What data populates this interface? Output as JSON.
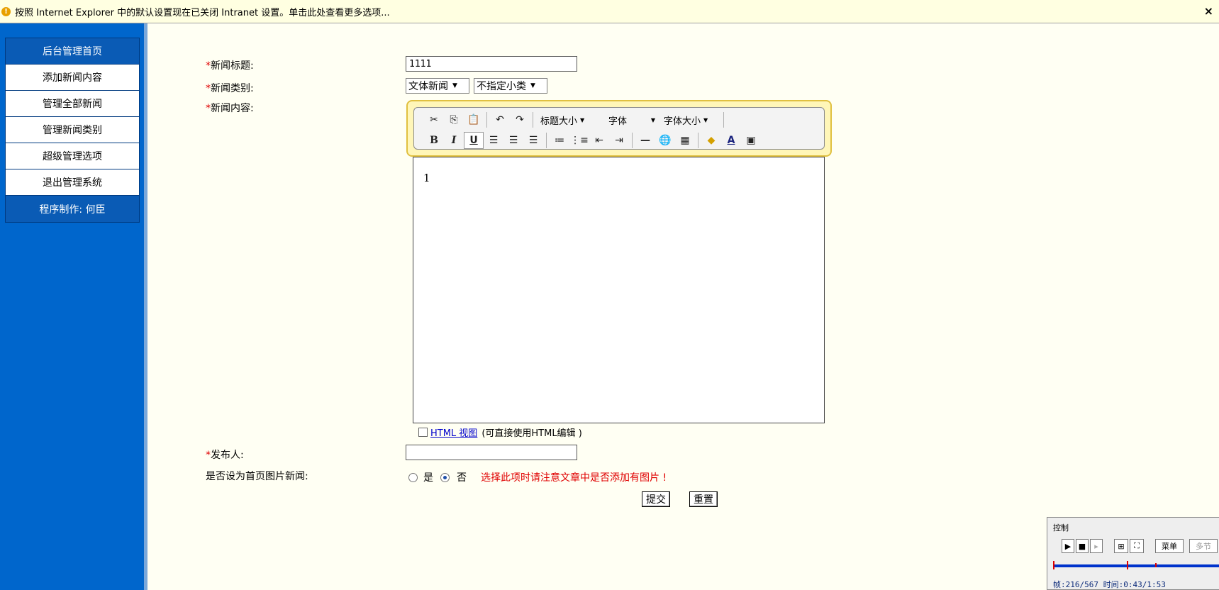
{
  "infobar": {
    "message": "按照 Internet Explorer 中的默认设置现在已关闭 Intranet 设置。单击此处查看更多选项...",
    "close": "×"
  },
  "sidebar": {
    "header": "后台管理首页",
    "items": [
      "添加新闻内容",
      "管理全部新闻",
      "管理新闻类别",
      "超级管理选项",
      "退出管理系统"
    ],
    "footer": "程序制作: 何臣"
  },
  "form": {
    "required_mark": "*",
    "title_label": "新闻标题:",
    "title_value": "1111",
    "category_label": "新闻类别:",
    "category_value": "文体新闻",
    "subcategory_value": "不指定小类",
    "content_label": "新闻内容:",
    "publisher_label": "发布人:",
    "publisher_value": "",
    "homepage_label": "是否设为首页图片新闻:",
    "yes": "是",
    "no": "否",
    "selected": "否",
    "warning": "选择此项时请注意文章中是否添加有图片 !",
    "warning_color": "#e00000",
    "submit": "提交",
    "reset": "重置"
  },
  "editor": {
    "heading_size": "标题大小",
    "font": "字体",
    "font_size": "字体大小",
    "content": "1",
    "html_view_link": "HTML 视图",
    "html_view_note": "(可直接使用HTML编辑 )",
    "html_view_checked": false
  },
  "player": {
    "title": "控制",
    "menu": "菜单",
    "multi": "多节",
    "info": "帧:216/567 时间:0:43/1:53"
  }
}
